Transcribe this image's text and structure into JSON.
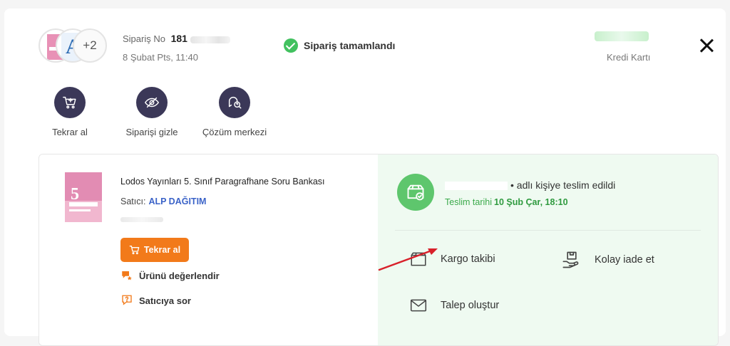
{
  "header": {
    "order_label": "Sipariş No",
    "order_number": "181",
    "order_date": "8 Şubat Pts, 11:40",
    "status": "Sipariş tamamlandı",
    "payment_method": "Kredi Kartı",
    "more_items": "+2",
    "thumb_letter": "A"
  },
  "actions": [
    {
      "label": "Tekrar al",
      "icon": "cart-plus-icon"
    },
    {
      "label": "Siparişi gizle",
      "icon": "eye-off-icon"
    },
    {
      "label": "Çözüm merkezi",
      "icon": "help-center-icon"
    }
  ],
  "product": {
    "title": "Lodos Yayınları 5. Sınıf Paragrafhane Soru Bankası",
    "seller_label": "Satıcı:",
    "seller_name": "ALP DAĞITIM",
    "buy_again": "Tekrar al",
    "review": "Ürünü değerlendir",
    "ask_seller": "Satıcıya sor",
    "cover_number": "5"
  },
  "delivery": {
    "recipient_suffix": "• adlı kişiye teslim edildi",
    "date_label": "Teslim tarihi",
    "date_value": "10 Şub Çar, 18:10",
    "tracking": "Kargo takibi",
    "easy_return": "Kolay iade et",
    "create_request": "Talep oluştur"
  },
  "colors": {
    "accent_orange": "#f27a1a",
    "success_green": "#42c15f",
    "action_circle": "#3b38 58",
    "seller_blue": "#3b63c8",
    "annotation_arrow": "#d8202a"
  }
}
